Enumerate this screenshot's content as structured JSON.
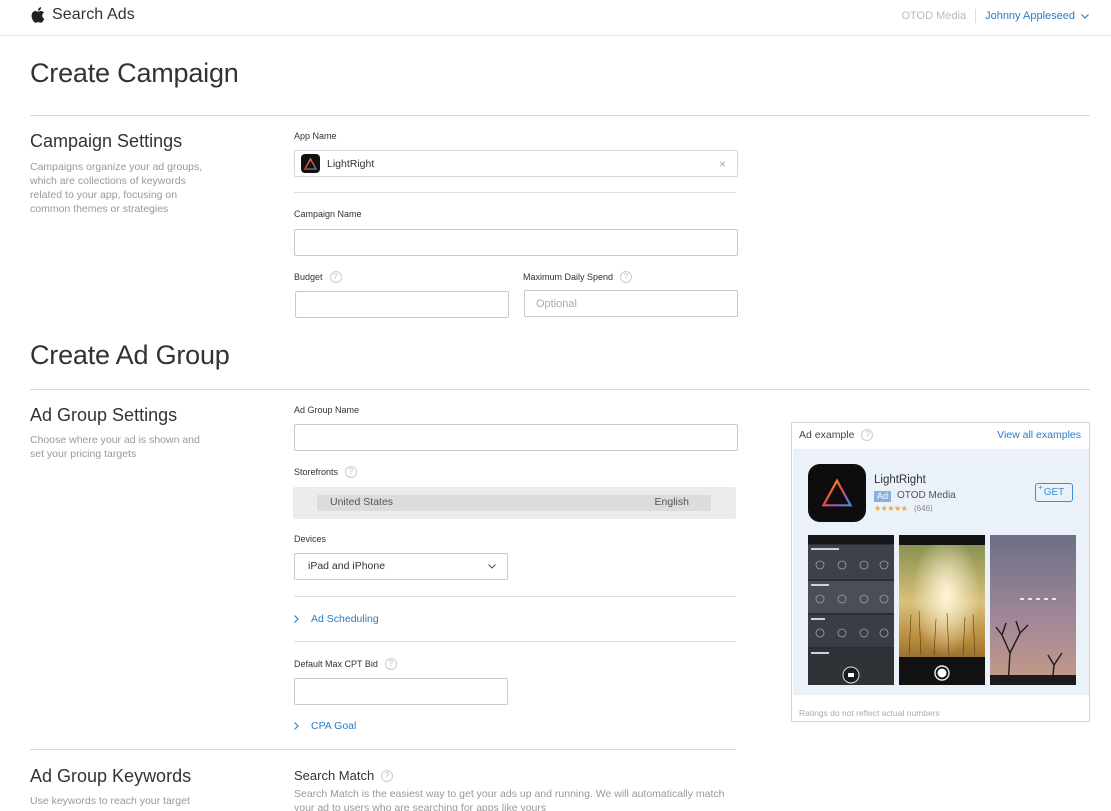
{
  "header": {
    "brand": "Search Ads",
    "org": "OTOD Media",
    "user": "Johnny Appleseed"
  },
  "campaign": {
    "heading": "Create Campaign",
    "settings_title": "Campaign Settings",
    "settings_desc": "Campaigns organize your ad groups, which are collections of keywords related to your app, focusing on common themes or strategies",
    "app_name_label": "App Name",
    "app_name_value": "LightRight",
    "campaign_name_label": "Campaign Name",
    "budget_label": "Budget",
    "max_daily_label": "Maximum Daily Spend",
    "max_daily_placeholder": "Optional"
  },
  "adgroup": {
    "heading": "Create Ad Group",
    "settings_title": "Ad Group Settings",
    "settings_desc": "Choose where your ad is shown and set your pricing targets",
    "name_label": "Ad Group Name",
    "storefronts_label": "Storefronts",
    "storefront_country": "United States",
    "storefront_language": "English",
    "devices_label": "Devices",
    "devices_value": "iPad and iPhone",
    "ad_scheduling": "Ad Scheduling",
    "cpt_label": "Default Max CPT Bid",
    "cpa_goal": "CPA Goal"
  },
  "keywords": {
    "title": "Ad Group Keywords",
    "desc": "Use keywords to reach your target",
    "search_match_title": "Search Match",
    "search_match_desc": "Search Match is the easiest way to get  your ads up and running. We will automatically match your ad to users who are searching for apps like yours"
  },
  "ad_example": {
    "title": "Ad example",
    "view_all": "View all examples",
    "app_name": "LightRight",
    "badge": "Ad",
    "developer": "OTOD Media",
    "stars": "★★★★★",
    "rating_count": "(646)",
    "get_label": "GET",
    "footnote": "Ratings do not reflect actual numbers"
  },
  "icons": {
    "brand": "apple-icon",
    "help": "question-icon",
    "clear": "close-icon",
    "dropdown": "chevron-down-icon",
    "expand": "chevron-right-icon",
    "app": "triangle-prism-icon"
  }
}
